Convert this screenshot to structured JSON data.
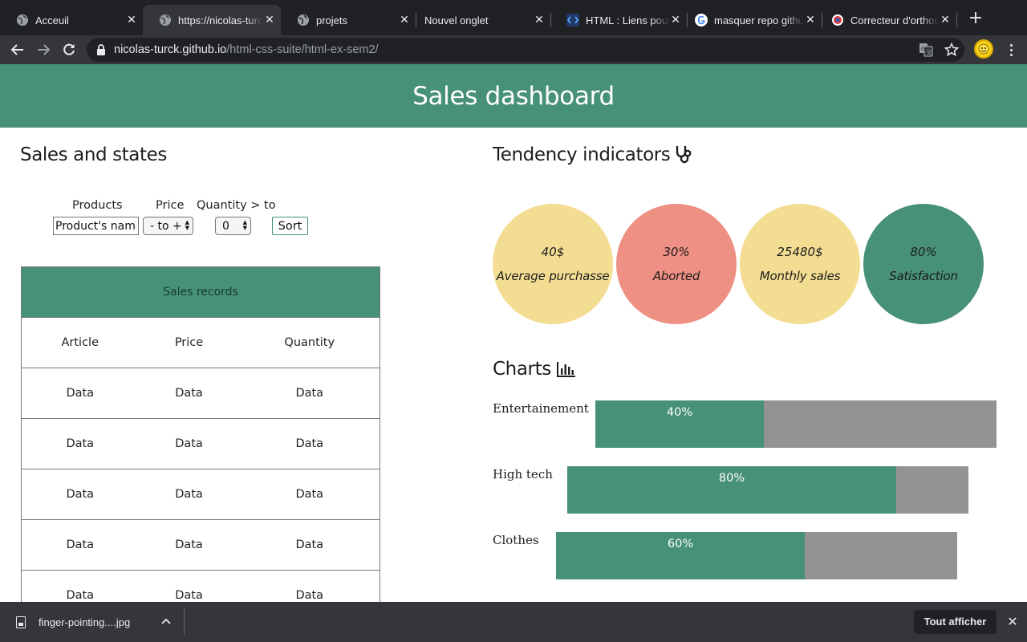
{
  "browser": {
    "tabs": [
      {
        "title": "Acceuil",
        "favicon": "globe-icon",
        "active": false
      },
      {
        "title": "https://nicolas-turck.github.io",
        "favicon": "globe-icon",
        "active": true
      },
      {
        "title": "projets",
        "favicon": "globe-icon",
        "active": false
      },
      {
        "title": "Nouvel onglet",
        "favicon": "",
        "active": false
      },
      {
        "title": "HTML : Liens pour naviguer",
        "favicon": "code-icon",
        "active": false
      },
      {
        "title": "masquer repo github",
        "favicon": "google-icon",
        "active": false
      },
      {
        "title": "Correcteur d'orthographe",
        "favicon": "scribens-icon",
        "active": false
      }
    ],
    "new_tab_label": "+",
    "address": {
      "host": "nicolas-turck.github.io",
      "path": "/html-css-suite/html-ex-sem2/"
    },
    "icons": {
      "back": "back-arrow-icon",
      "forward": "forward-arrow-icon",
      "reload": "reload-icon",
      "lock": "lock-icon",
      "translate": "translate-icon",
      "bookmark": "star-icon",
      "profile": "avatar",
      "menu": "kebab-menu-icon"
    }
  },
  "page": {
    "header_title": "Sales dashboard",
    "sales_section_title": "Sales and states",
    "filters": {
      "products_label": "Products",
      "price_label": "Price",
      "quantity_label": "Quantity > to",
      "product_input_value": "Product's name",
      "price_select_value": "- to +",
      "quantity_select_value": "0",
      "sort_label": "Sort"
    },
    "table": {
      "caption": "Sales records",
      "columns": [
        "Article",
        "Price",
        "Quantity"
      ],
      "rows": [
        [
          "Data",
          "Data",
          "Data"
        ],
        [
          "Data",
          "Data",
          "Data"
        ],
        [
          "Data",
          "Data",
          "Data"
        ],
        [
          "Data",
          "Data",
          "Data"
        ],
        [
          "Data",
          "Data",
          "Data"
        ]
      ]
    },
    "tendency": {
      "title": "Tendency indicators",
      "icon": "stethoscope-icon",
      "indicators": [
        {
          "value": "40$",
          "label": "Average purchasse",
          "color": "#f3dd92"
        },
        {
          "value": "30%",
          "label": "Aborted",
          "color": "#ee9083"
        },
        {
          "value": "25480$",
          "label": "Monthly sales",
          "color": "#f3dd92"
        },
        {
          "value": "80%",
          "label": "Satisfaction",
          "color": "#479178"
        }
      ]
    },
    "charts": {
      "title": "Charts",
      "icon": "bar-chart-icon",
      "bars": [
        {
          "label": "Entertainement",
          "value_text": "40%",
          "fraction": 0.42
        },
        {
          "label": "High tech",
          "value_text": "80%",
          "fraction": 0.82
        },
        {
          "label": "Clothes",
          "value_text": "60%",
          "fraction": 0.62
        }
      ]
    },
    "colors": {
      "primary": "#479178",
      "yellow": "#f3dd92",
      "salmon": "#ee9083",
      "bar_track": "#939393"
    }
  },
  "downloads": {
    "file_name": "finger-pointing....jpg",
    "show_all_label": "Tout afficher",
    "close_label": "✕"
  }
}
